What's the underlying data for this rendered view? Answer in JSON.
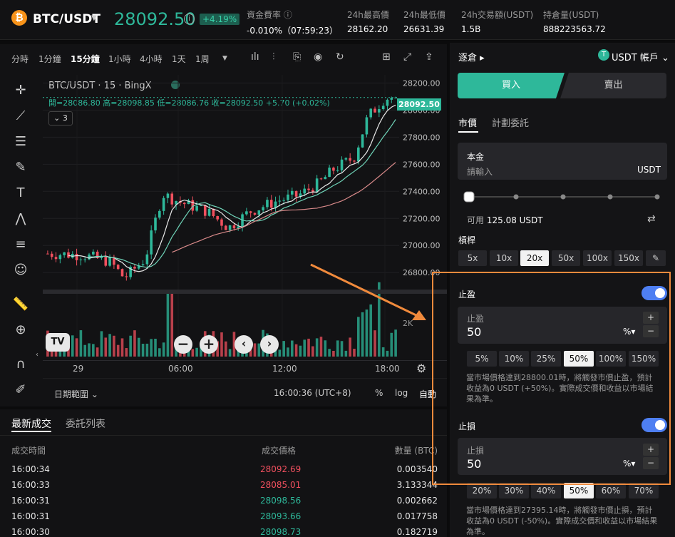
{
  "header": {
    "coin_glyph": "₿",
    "pair": "BTC/USDT",
    "price": "28092.50",
    "change": "+4.19%",
    "stats": [
      {
        "label": "資金費率 ⓘ",
        "value": "-0.010%（07:59:23）"
      },
      {
        "label": "24h最高價",
        "value": "28162.20"
      },
      {
        "label": "24h最低價",
        "value": "26631.39"
      },
      {
        "label": "24h交易額(USDT)",
        "value": "1.5B"
      },
      {
        "label": "持倉量(USDT)",
        "value": "888223563.72"
      }
    ]
  },
  "toolbar": {
    "intervals": [
      "分時",
      "1分鐘",
      "15分鐘",
      "1小時",
      "4小時",
      "1天",
      "1周"
    ],
    "active": "15分鐘"
  },
  "chart": {
    "symbol": "BTC/USDT · 15 · BingX",
    "ohlc": "開=28086.80 高=28098.85 低=28086.76 收=28092.50 +5.70 (+0.02%)",
    "indicator_count": "3",
    "last_price": "28092.50",
    "volume_label": "2K",
    "time": "16:00:36 (UTC+8)",
    "date_range": "日期範圍",
    "pct": "%",
    "log": "log",
    "auto": "自動"
  },
  "chart_data": {
    "type": "candlestick",
    "yticks": [
      26800,
      27000,
      27200,
      27400,
      27600,
      27800,
      28000,
      28200
    ],
    "xticks": [
      "29",
      "06:00",
      "12:00",
      "18:00"
    ],
    "ylim": [
      26680,
      28260
    ],
    "last": 28092.5
  },
  "trades": {
    "tabs": [
      "最新成交",
      "委託列表"
    ],
    "headers": [
      "成交時間",
      "成交價格",
      "數量 (BTC)"
    ],
    "rows": [
      {
        "t": "16:00:34",
        "p": "28092.69",
        "q": "0.003540",
        "c": "#f0505e"
      },
      {
        "t": "16:00:33",
        "p": "28085.01",
        "q": "3.133344",
        "c": "#f0505e"
      },
      {
        "t": "16:00:31",
        "p": "28098.56",
        "q": "0.002662",
        "c": "#2eb89a"
      },
      {
        "t": "16:00:31",
        "p": "28093.66",
        "q": "0.017758",
        "c": "#2eb89a"
      },
      {
        "t": "16:00:30",
        "p": "28098.73",
        "q": "0.182719",
        "c": "#2eb89a"
      }
    ]
  },
  "panel": {
    "mode": "逐倉",
    "account": "USDT 帳戶",
    "buy": "買入",
    "sell": "賣出",
    "tabs": [
      "市價",
      "計劃委託"
    ],
    "principal_label": "本金",
    "principal_placeholder": "請輸入",
    "unit": "USDT",
    "available_label": "可用",
    "available": "125.08 USDT",
    "slider_level": 0,
    "leverage_label": "槓桿",
    "leverage": [
      "5x",
      "10x",
      "20x",
      "50x",
      "100x",
      "150x"
    ],
    "leverage_selected": "20x",
    "tp_label": "止盈",
    "tp_field": "止盈",
    "tp_value": "50",
    "tp_unit": "%",
    "tp_pcts": [
      "5%",
      "10%",
      "25%",
      "50%",
      "100%",
      "150%"
    ],
    "tp_selected": "50%",
    "tp_note": "當市場價格達到28800.01時，將觸發市價止盈，預計收益為0 USDT (+50%)。實際成交價和收益以市場結果為準。",
    "sl_label": "止損",
    "sl_field": "止損",
    "sl_value": "50",
    "sl_unit": "%",
    "sl_pcts": [
      "20%",
      "30%",
      "40%",
      "50%",
      "60%",
      "70%"
    ],
    "sl_selected": "50%",
    "sl_note": "當市場價格達到27395.14時，將觸發市價止損，預計收益為0 USDT (-50%)。實際成交價和收益以市場結果為準。"
  },
  "colors": {
    "up": "#2eb89a",
    "down": "#f0505e",
    "accent": "#2eb89a",
    "highlight": "#f08a3c"
  }
}
